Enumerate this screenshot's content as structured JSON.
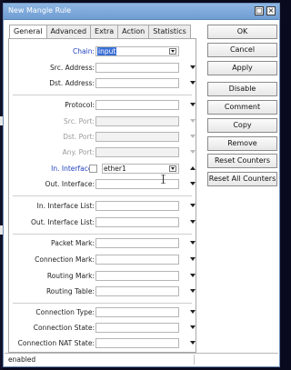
{
  "window": {
    "title": "New Mangle Rule",
    "max_glyph": "□",
    "close_glyph": "×"
  },
  "tabs": [
    "General",
    "Advanced",
    "Extra",
    "Action",
    "Statistics"
  ],
  "form": {
    "chain": {
      "label": "Chain:",
      "value": "input"
    },
    "src_address": {
      "label": "Src. Address:",
      "value": ""
    },
    "dst_address": {
      "label": "Dst. Address:",
      "value": ""
    },
    "protocol": {
      "label": "Protocol:",
      "value": ""
    },
    "src_port": {
      "label": "Src. Port:",
      "value": ""
    },
    "dst_port": {
      "label": "Dst. Port:",
      "value": ""
    },
    "any_port": {
      "label": "Any. Port:",
      "value": ""
    },
    "in_interface": {
      "label": "In. Interface:",
      "value": "ether1"
    },
    "out_interface": {
      "label": "Out. Interface:",
      "value": ""
    },
    "in_interface_list": {
      "label": "In. Interface List:",
      "value": ""
    },
    "out_interface_list": {
      "label": "Out. Interface List:",
      "value": ""
    },
    "packet_mark": {
      "label": "Packet Mark:",
      "value": ""
    },
    "connection_mark": {
      "label": "Connection Mark:",
      "value": ""
    },
    "routing_mark": {
      "label": "Routing Mark:",
      "value": ""
    },
    "routing_table": {
      "label": "Routing Table:",
      "value": ""
    },
    "connection_type": {
      "label": "Connection Type:",
      "value": ""
    },
    "connection_state": {
      "label": "Connection State:",
      "value": ""
    },
    "connection_nat_state": {
      "label": "Connection NAT State:",
      "value": ""
    }
  },
  "buttons": {
    "ok": "OK",
    "cancel": "Cancel",
    "apply": "Apply",
    "disable": "Disable",
    "comment": "Comment",
    "copy": "Copy",
    "remove": "Remove",
    "reset_counters": "Reset Counters",
    "reset_all_counters": "Reset All Counters"
  },
  "status": {
    "text": "enabled"
  }
}
